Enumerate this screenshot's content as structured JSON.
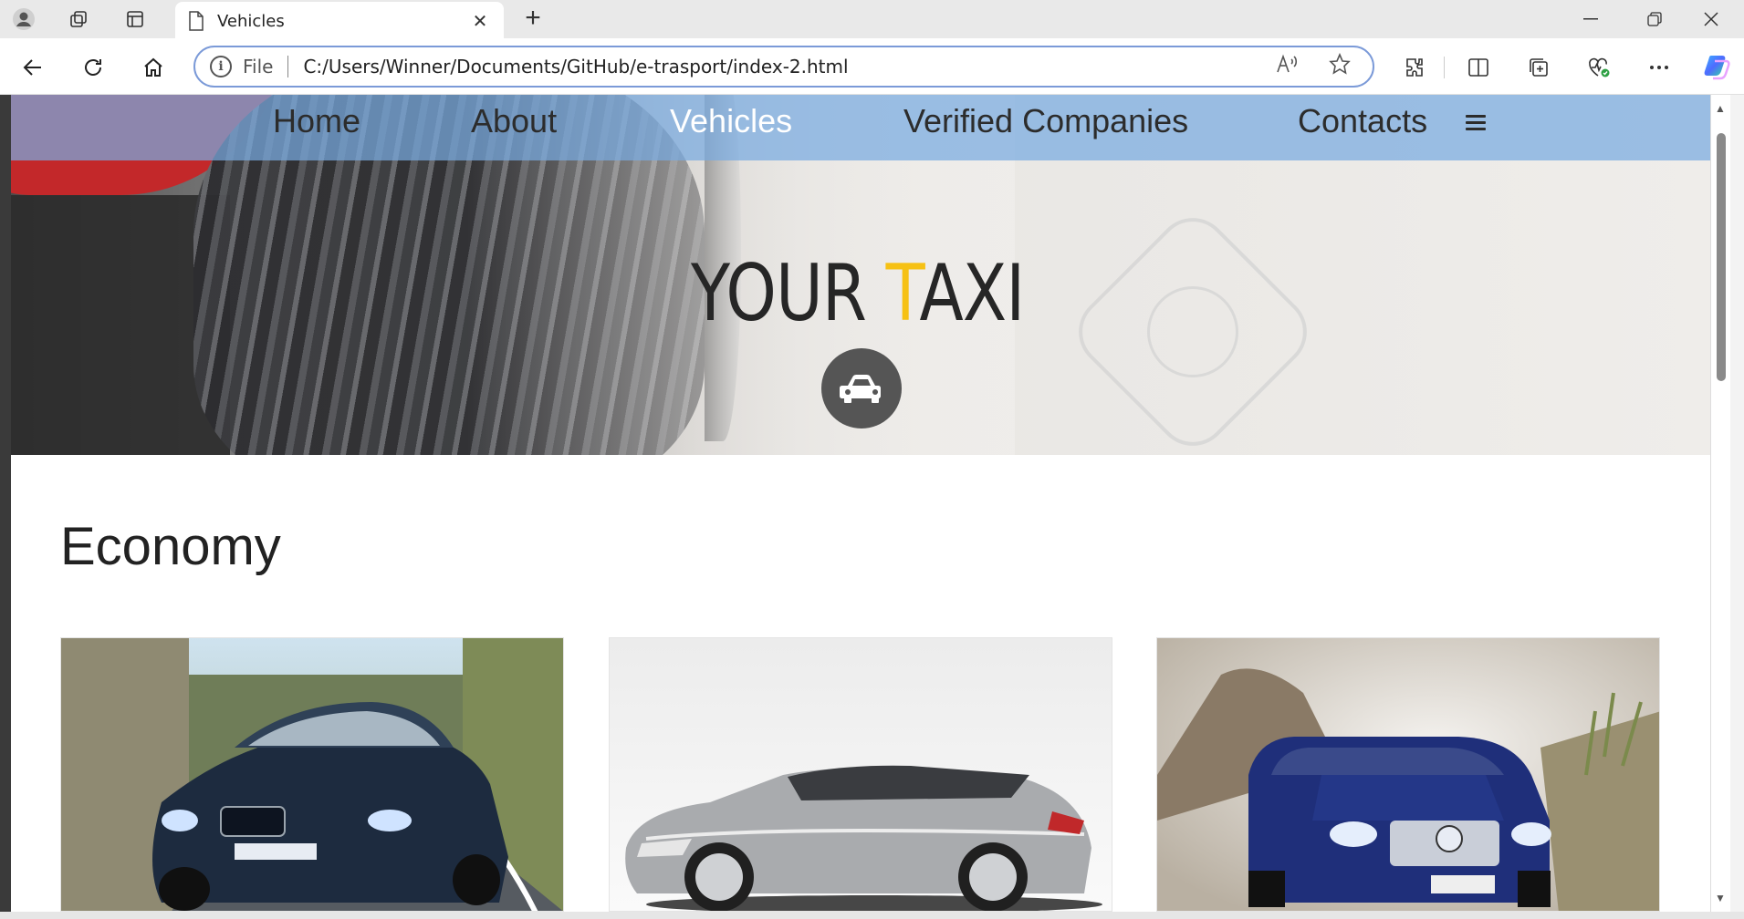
{
  "browser": {
    "tab_title": "Vehicles",
    "address_scheme": "File",
    "url": "C:/Users/Winner/Documents/GitHub/e-trasport/index-2.html",
    "read_aloud_label": "A⁾"
  },
  "nav": {
    "items": [
      {
        "label": "Home",
        "active": false
      },
      {
        "label": "About",
        "active": false
      },
      {
        "label": "Vehicles",
        "active": true
      },
      {
        "label": "Verified Companies",
        "active": false
      },
      {
        "label": "Contacts",
        "active": false
      }
    ]
  },
  "hero": {
    "brand_prefix": "YOUR ",
    "brand_accent": "T",
    "brand_suffix": "AXI",
    "accent_color": "#f6c114"
  },
  "section": {
    "title": "Economy"
  },
  "vehicles": [
    {
      "icon": "dark-blue-estate-car",
      "color": "#1d2b3f"
    },
    {
      "icon": "silver-sport-wagon",
      "color": "#a9abae"
    },
    {
      "icon": "blue-suv",
      "color": "#1f2f7a"
    }
  ],
  "colors": {
    "nav_bg": "#78aae1",
    "active_nav_text": "#ffffff",
    "address_border": "#7b9ad8"
  }
}
